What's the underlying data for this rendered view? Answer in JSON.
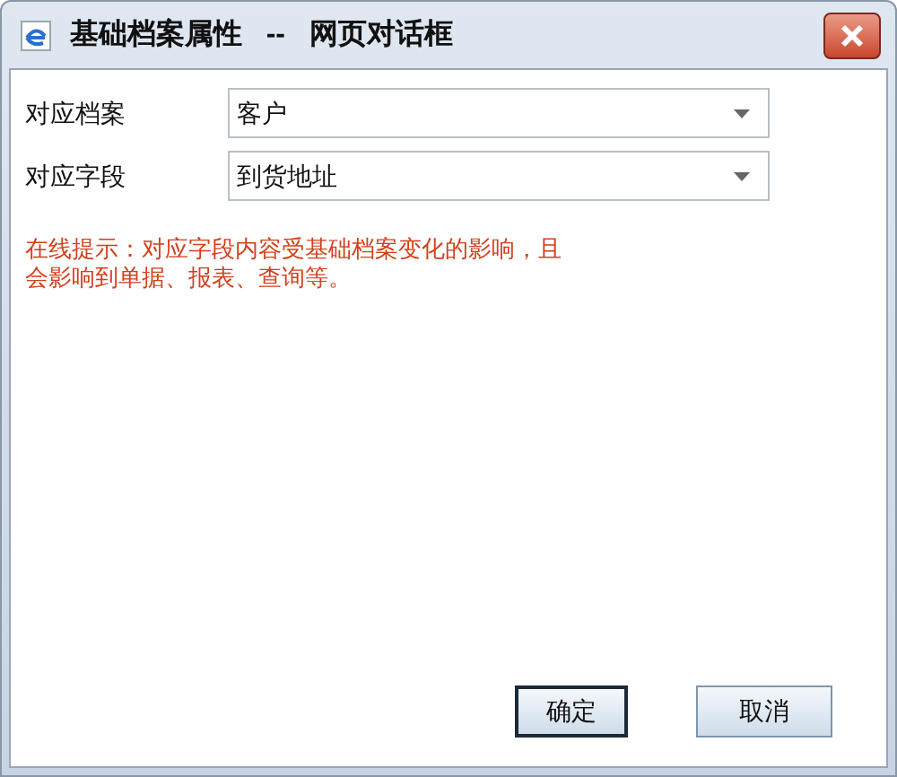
{
  "window": {
    "title": "基础档案属性   --   网页对话框"
  },
  "fields": [
    {
      "label": "对应档案",
      "value": "客户"
    },
    {
      "label": "对应字段",
      "value": "到货地址"
    }
  ],
  "hint": "在线提示：对应字段内容受基础档案变化的影响，且会影响到单据、报表、查询等。",
  "buttons": [
    {
      "label": "确定",
      "default": true
    },
    {
      "label": "取消",
      "default": false
    }
  ]
}
